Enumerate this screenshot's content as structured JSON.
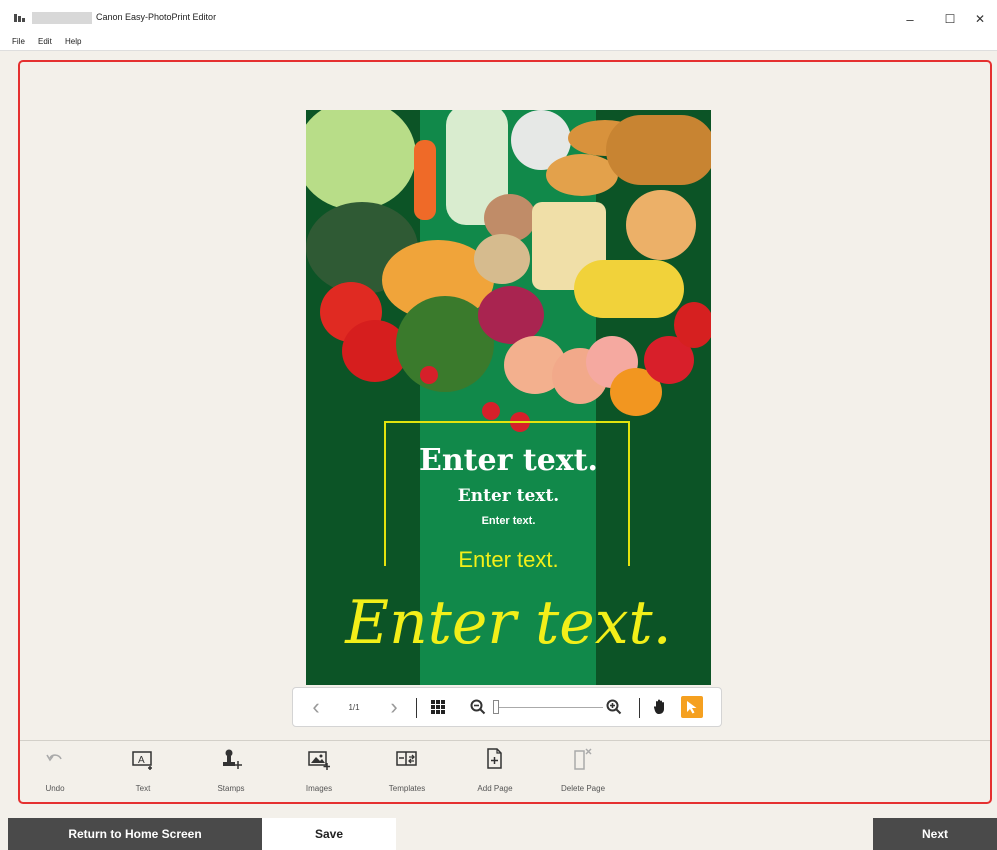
{
  "window": {
    "title": "Canon Easy-PhotoPrint Editor",
    "minimize_glyph": "–",
    "maximize_glyph": "☐",
    "close_glyph": "✕"
  },
  "menu": {
    "file": "File",
    "edit": "Edit",
    "help": "Help"
  },
  "poster": {
    "text1": "Enter text.",
    "text2": "Enter text.",
    "text3": "Enter text.",
    "text4": "Enter text.",
    "text5": "Enter text.",
    "text_color_white": "#ffffff",
    "text_color_yellow": "#f2ef19",
    "background": "#0a5a2a"
  },
  "pagebar": {
    "prev_glyph": "‹",
    "page": "1/1",
    "next_glyph": "›",
    "zoom_level": 0.0
  },
  "tools": {
    "undo": "Undo",
    "text": "Text",
    "stamps": "Stamps",
    "images": "Images",
    "templates": "Templates",
    "add_page": "Add Page",
    "delete_page": "Delete Page"
  },
  "footer": {
    "home": "Return to Home Screen",
    "save": "Save",
    "next": "Next"
  },
  "colors": {
    "highlight": "#e53030",
    "accent": "#f5a020"
  }
}
